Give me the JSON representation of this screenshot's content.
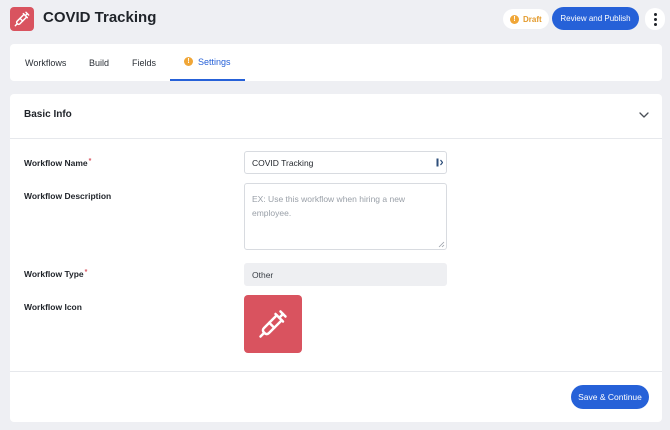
{
  "header": {
    "app_icon": "syringe-icon",
    "title": "COVID Tracking",
    "status_badge": "Draft",
    "publish_label": "Review and Publish",
    "more_icon": "more-vertical-icon"
  },
  "tabs": [
    {
      "label": "Workflows",
      "active": false
    },
    {
      "label": "Build",
      "active": false
    },
    {
      "label": "Fields",
      "active": false
    },
    {
      "label": "Settings",
      "active": true,
      "icon": "warning-icon"
    }
  ],
  "section": {
    "title": "Basic Info",
    "collapse_icon": "chevron-down-icon"
  },
  "form": {
    "name_label": "Workflow Name",
    "name_value": "COVID Tracking",
    "description_label": "Workflow Description",
    "description_placeholder": "EX: Use this workflow when hiring a new employee.",
    "type_label": "Workflow Type",
    "type_value": "Other",
    "icon_label": "Workflow Icon",
    "icon_value": "syringe-icon",
    "required_mark": "*"
  },
  "footer": {
    "save_label": "Save & Continue"
  },
  "colors": {
    "accent": "#2661d8",
    "icon_bg": "#d9535f",
    "warning": "#f0a637",
    "page_bg": "#eeeff3"
  }
}
